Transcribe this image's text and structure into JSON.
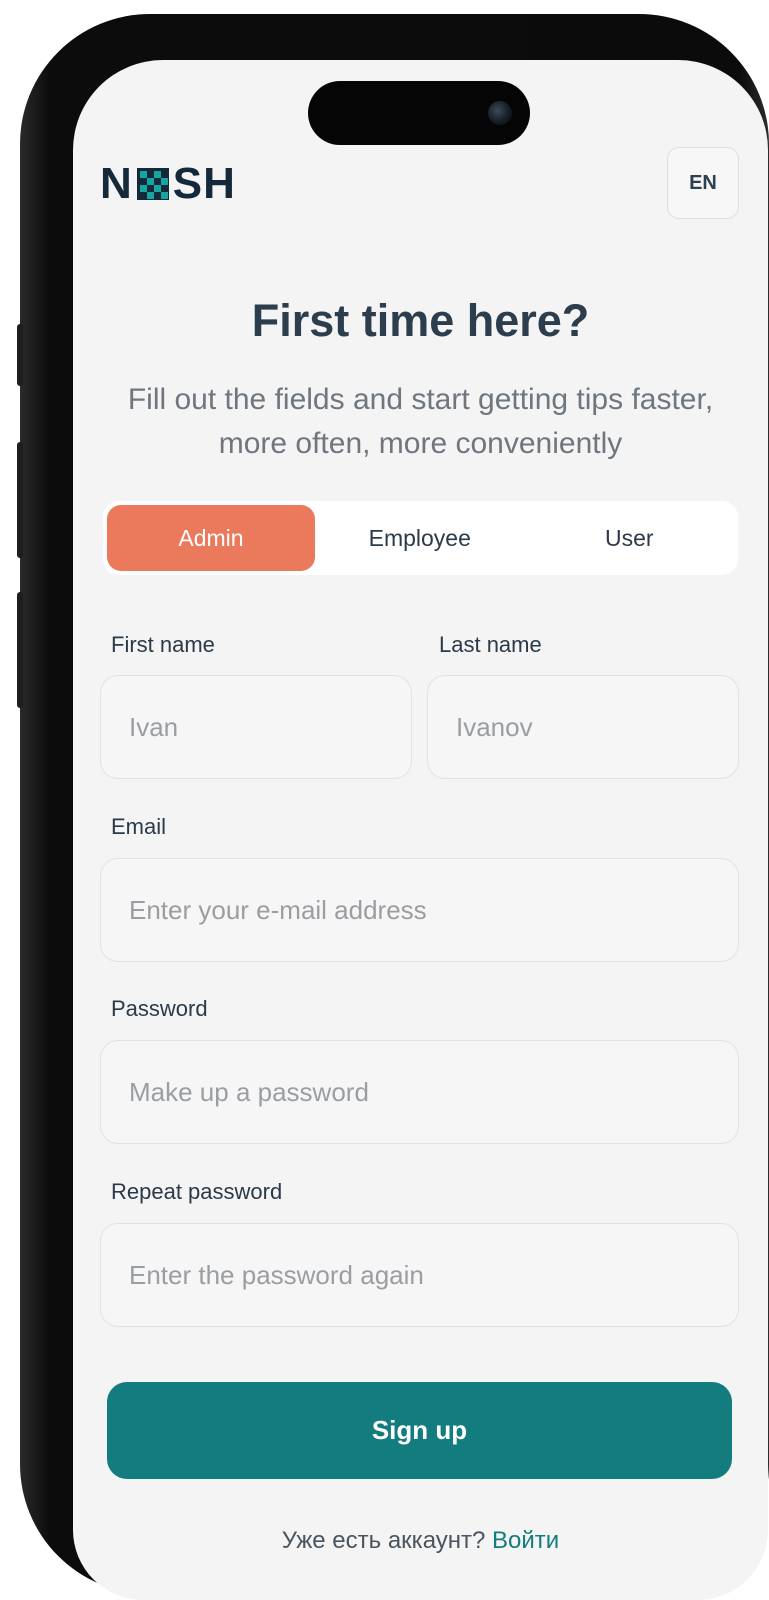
{
  "header": {
    "logo_left": "N",
    "logo_right": "SH",
    "language": "EN"
  },
  "hero": {
    "title": "First time here?",
    "subtitle": "Fill out the fields and start getting tips faster, more often, more conveniently"
  },
  "role_tabs": {
    "items": [
      {
        "label": "Admin",
        "active": true
      },
      {
        "label": "Employee",
        "active": false
      },
      {
        "label": "User",
        "active": false
      }
    ]
  },
  "form": {
    "first_name": {
      "label": "First name",
      "placeholder": "Ivan"
    },
    "last_name": {
      "label": "Last name",
      "placeholder": "Ivanov"
    },
    "email": {
      "label": "Email",
      "placeholder": "Enter your e-mail address"
    },
    "password": {
      "label": "Password",
      "placeholder": "Make up a password"
    },
    "repeat_password": {
      "label": "Repeat password",
      "placeholder": "Enter the password again"
    },
    "submit_label": "Sign up"
  },
  "footer": {
    "prompt": "Уже есть аккаунт?",
    "login_link": "Войти"
  },
  "colors": {
    "accent_tab": "#eb7a5c",
    "primary_button": "#137c7e",
    "logo_text": "#15293b",
    "logo_teal": "#14a6a0"
  },
  "icons": {
    "logo_mark": "checkered-square-icon"
  }
}
